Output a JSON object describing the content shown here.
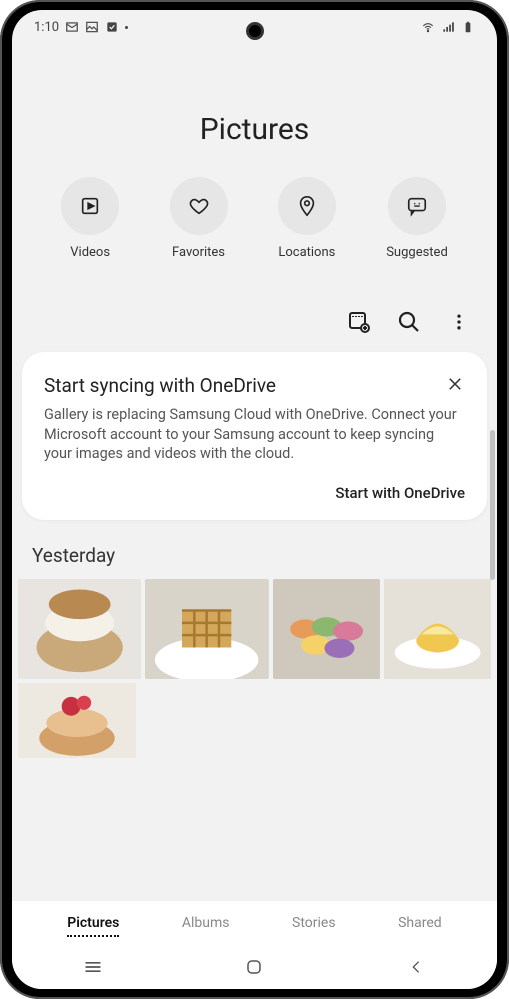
{
  "status": {
    "time": "1:10",
    "left_icons": [
      "mail-icon",
      "image-icon",
      "check-icon",
      "dot-icon"
    ],
    "right_icons": [
      "wifi-icon",
      "signal-icon",
      "battery-icon"
    ]
  },
  "header": {
    "title": "Pictures",
    "categories": [
      {
        "icon": "play-icon",
        "label": "Videos"
      },
      {
        "icon": "heart-icon",
        "label": "Favorites"
      },
      {
        "icon": "pin-icon",
        "label": "Locations"
      },
      {
        "icon": "sparkle-chat-icon",
        "label": "Suggested"
      }
    ]
  },
  "actions": {
    "items": [
      "gif-add-icon",
      "search-icon",
      "more-icon"
    ]
  },
  "sync_card": {
    "title": "Start syncing with OneDrive",
    "body": "Gallery is replacing Samsung Cloud with OneDrive. Connect your Microsoft account to your Samsung account to keep syncing your images and videos with the cloud.",
    "action_label": "Start with OneDrive"
  },
  "sections": [
    {
      "title": "Yesterday",
      "photos_row1": 4,
      "photos_row2": 1
    }
  ],
  "tabs": {
    "items": [
      "Pictures",
      "Albums",
      "Stories",
      "Shared"
    ],
    "active": "Pictures"
  }
}
